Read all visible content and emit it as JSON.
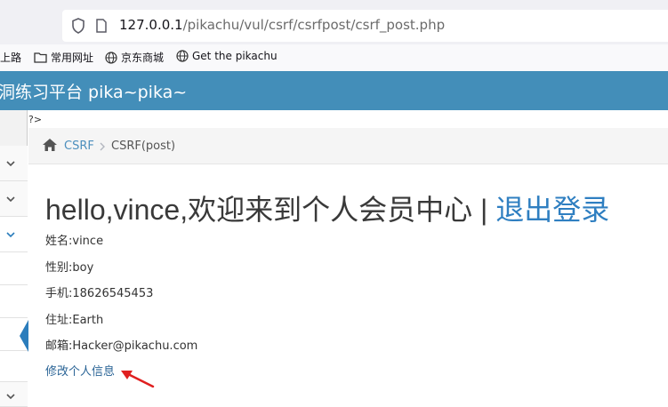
{
  "browser": {
    "url_host": "127.0.0.1",
    "url_path": "/pikachu/vul/csrf/csrfpost/csrf_post.php",
    "bookmarks": [
      "上路",
      "常用网址",
      "京东商城",
      "Get the pikachu"
    ]
  },
  "site": {
    "title": "洞练习平台 pika~pika~",
    "php_leak": "?>"
  },
  "breadcrumb": {
    "parent": "CSRF",
    "current": "CSRF(post)"
  },
  "main": {
    "welcome": "hello,vince,欢迎来到个人会员中心 | ",
    "logout": "退出登录",
    "info": [
      "姓名:vince",
      "性别:boy",
      "手机:18626545453",
      "住址:Earth",
      "邮箱:Hacker@pikachu.com"
    ],
    "edit_link": "修改个人信息"
  },
  "colors": {
    "header": "#438eb9",
    "link": "#4c8fbd",
    "logout": "#2f7fc1",
    "annotation": "#e02020"
  }
}
